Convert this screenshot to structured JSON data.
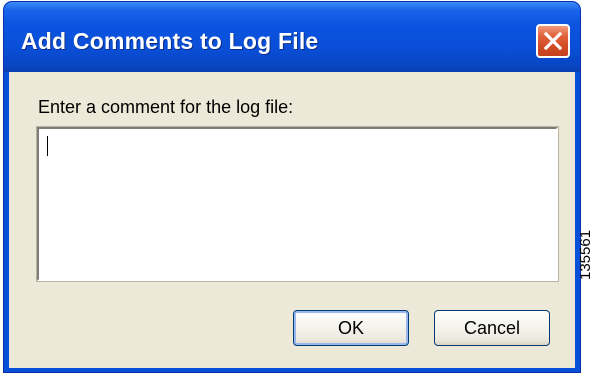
{
  "window": {
    "title": "Add Comments to Log File",
    "close_icon": "close-icon"
  },
  "dialog": {
    "prompt_label": "Enter a comment for the log file:",
    "comment_value": "",
    "ok_label": "OK",
    "cancel_label": "Cancel"
  },
  "figure_id": "135561",
  "colors": {
    "titlebar": "#0a4fd8",
    "close_button": "#d24a23",
    "dialog_background": "#ece9d8",
    "input_background": "#ffffff"
  }
}
